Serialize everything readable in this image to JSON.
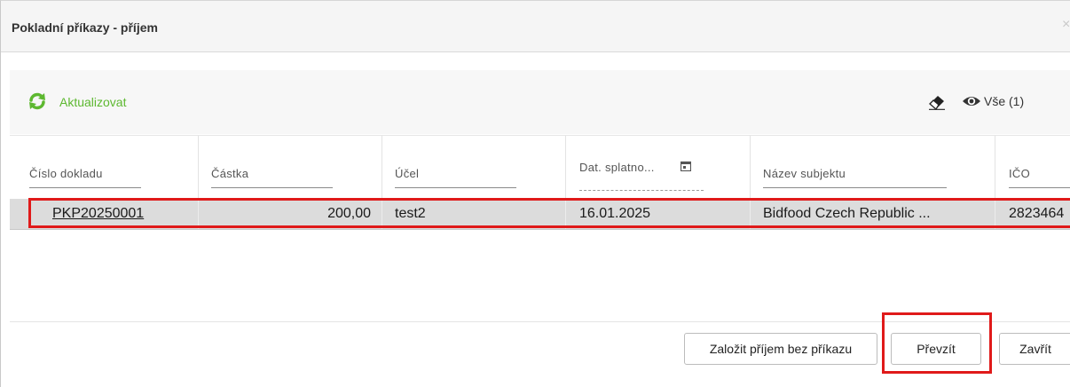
{
  "dialog": {
    "title": "Pokladní příkazy - příjem",
    "close_glyph": "×"
  },
  "toolbar": {
    "refresh_label": "Aktualizovat",
    "refresh_color": "#5db830",
    "filter_label": "Vše (1)"
  },
  "grid": {
    "columns": [
      "Číslo dokladu",
      "Částka",
      "Účel",
      "Dat. splatno...",
      "Název subjektu",
      "IČO"
    ],
    "rows": [
      {
        "cislo": "PKP20250001",
        "castka": "200,00",
        "ucel": "test2",
        "datum": "16.01.2025",
        "nazev": "Bidfood Czech Republic ...",
        "ico": "2823464"
      }
    ]
  },
  "footer": {
    "create_label": "Založit příjem bez příkazu",
    "take_label": "Převzít",
    "close_label": "Zavřít"
  },
  "highlight_color": "#e01a1a"
}
